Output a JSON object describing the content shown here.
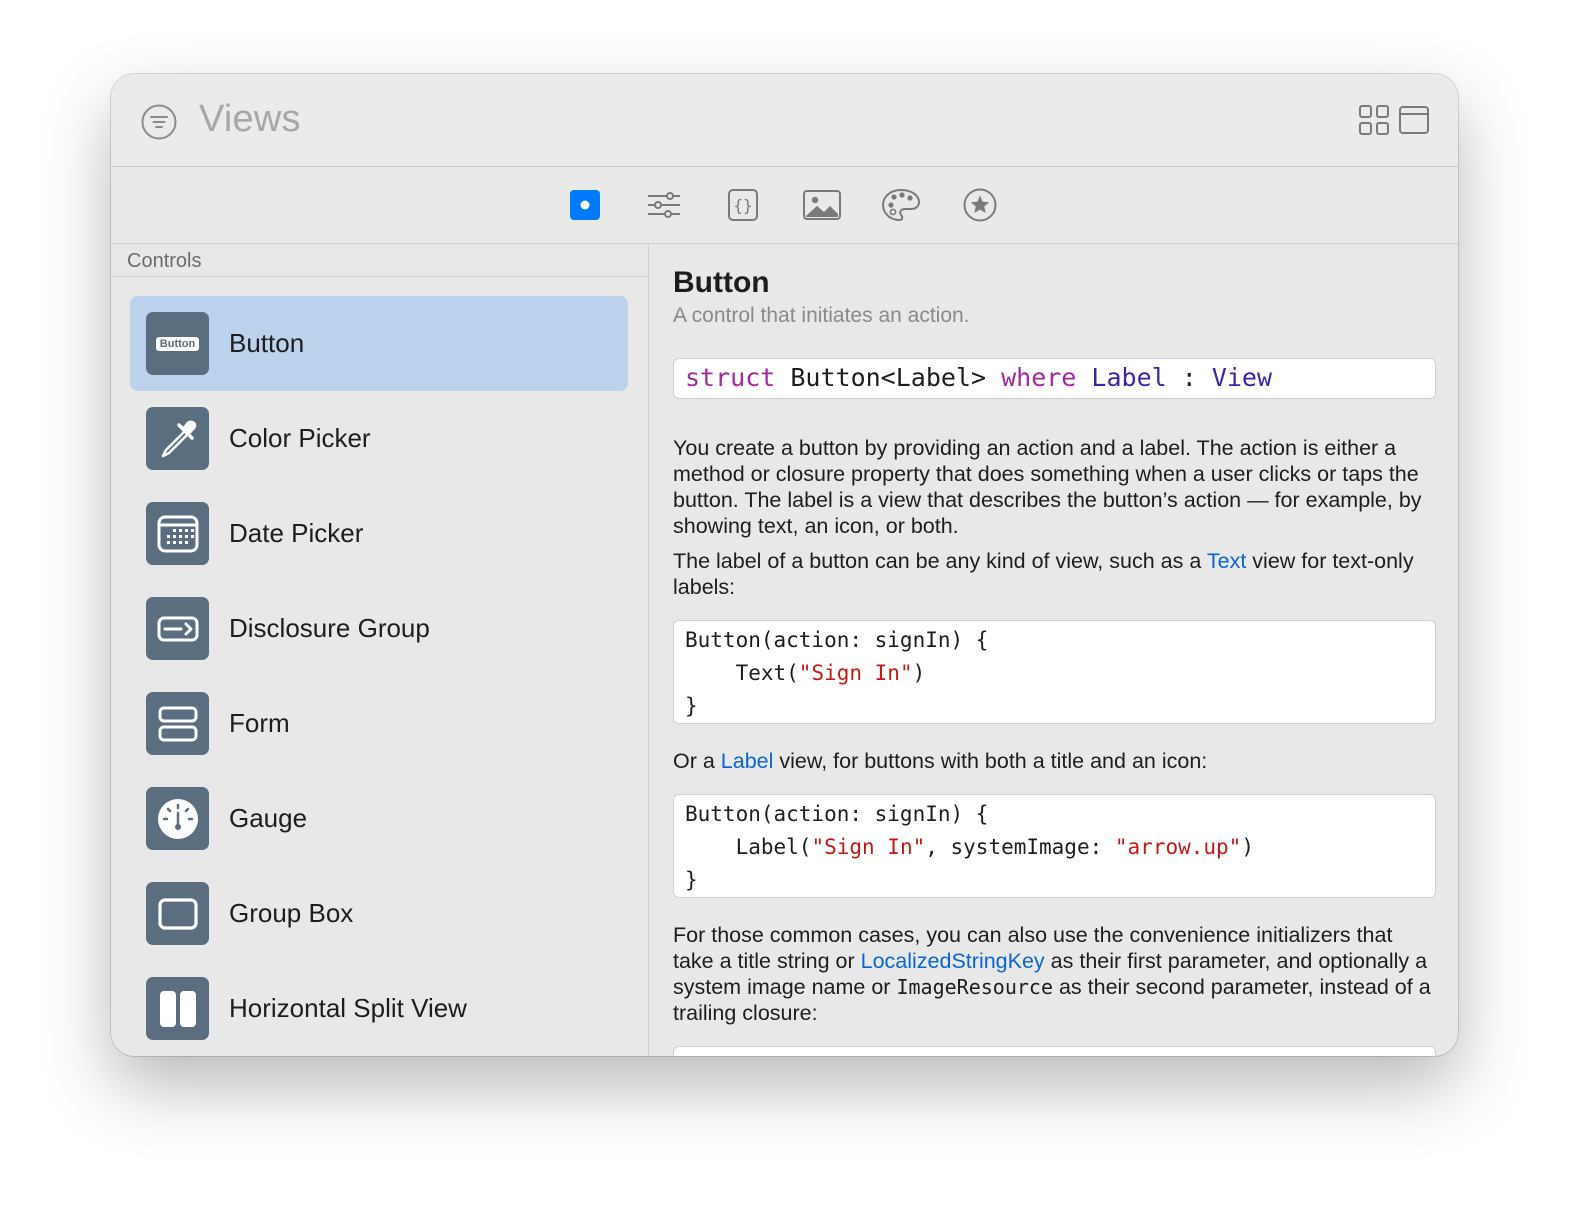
{
  "window": {
    "title": "Views"
  },
  "toolbar": {
    "tabs": [
      {
        "icon": "selected-dot-icon",
        "selected": true
      },
      {
        "icon": "sliders-icon",
        "selected": false
      },
      {
        "icon": "braces-document-icon",
        "selected": false
      },
      {
        "icon": "photo-icon",
        "selected": false
      },
      {
        "icon": "palette-icon",
        "selected": false
      },
      {
        "icon": "star-circle-icon",
        "selected": false
      }
    ]
  },
  "sidebar": {
    "section": "Controls",
    "items": [
      {
        "label": "Button",
        "icon": "button-icon",
        "icon_text": "Button",
        "selected": true
      },
      {
        "label": "Color Picker",
        "icon": "eyedropper-icon"
      },
      {
        "label": "Date Picker",
        "icon": "calendar-icon"
      },
      {
        "label": "Disclosure Group",
        "icon": "disclosure-icon"
      },
      {
        "label": "Form",
        "icon": "form-icon"
      },
      {
        "label": "Gauge",
        "icon": "gauge-icon"
      },
      {
        "label": "Group Box",
        "icon": "group-box-icon"
      },
      {
        "label": "Horizontal Split View",
        "icon": "split-view-icon"
      }
    ]
  },
  "detail": {
    "title": "Button",
    "subtitle": "A control that initiates an action.",
    "declaration": {
      "kw_struct": "struct",
      "name": " Button<Label> ",
      "kw_where": "where",
      "label_type": " Label",
      "colon": " : ",
      "view_type": "View"
    },
    "p1": "You create a button by providing an action and a label. The action is either a method or closure property that does something when a user clicks or taps the button. The label is a view that describes the button’s action — for example, by showing text, an icon, or both.",
    "p2": {
      "before": "The label of a button can be any kind of view, such as a ",
      "link": "Text",
      "after": " view for text-only labels:"
    },
    "code1": {
      "line1": "Button(action: signIn) {",
      "line2_pre": "    Text(",
      "line2_str": "\"Sign In\"",
      "line2_post": ")",
      "line3": "}"
    },
    "p3": {
      "before": "Or a ",
      "link": "Label",
      "after": " view, for buttons with both a title and an icon:"
    },
    "code2": {
      "line1": "Button(action: signIn) {",
      "line2_pre": "    Label(",
      "line2_str1": "\"Sign In\"",
      "line2_mid": ", systemImage: ",
      "line2_str2": "\"arrow.up\"",
      "line2_post": ")",
      "line3": "}"
    },
    "p4": {
      "before": "For those common cases, you can also use the convenience initializers that take a title string or ",
      "link": "LocalizedStringKey",
      "middle": " as their first parameter, and optionally a system image name or ",
      "mono": "ImageResource",
      "after": " as their second parameter, instead of a trailing closure:"
    }
  },
  "colors": {
    "accent": "#007aff",
    "selection": "#bcd1ec",
    "icon_tile": "#5a6e80",
    "keyword": "#a2289e",
    "type": "#3f25a5",
    "string": "#c41a16",
    "link": "#0a64d6"
  }
}
